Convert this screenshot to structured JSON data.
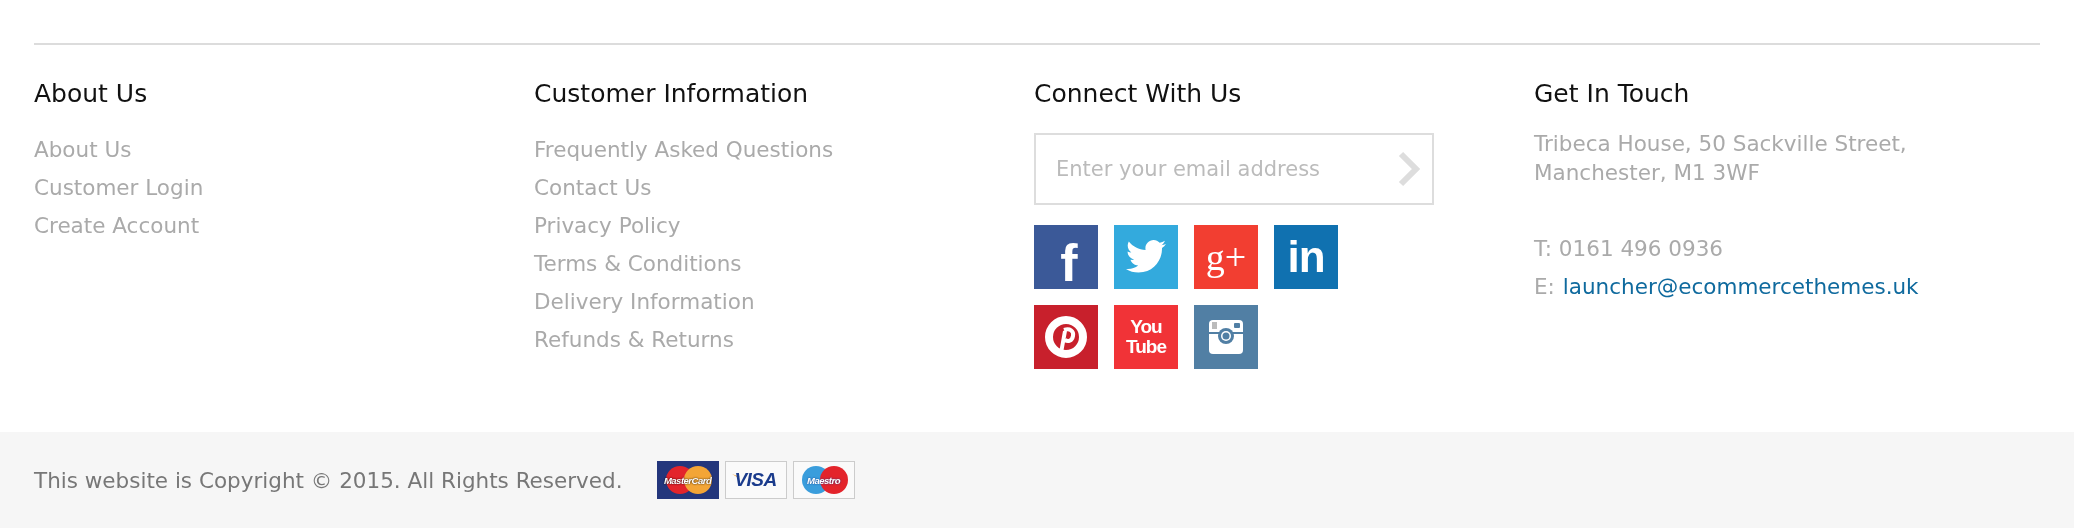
{
  "columns": [
    {
      "heading": "About Us",
      "links": [
        "About Us",
        "Customer Login",
        "Create Account"
      ]
    },
    {
      "heading": "Customer Information",
      "links": [
        "Frequently Asked Questions",
        "Contact Us",
        "Privacy Policy",
        "Terms & Conditions",
        "Delivery Information",
        "Refunds & Returns"
      ]
    }
  ],
  "connect": {
    "heading": "Connect With Us",
    "newsletter": {
      "placeholder": "Enter your email address"
    },
    "social": [
      {
        "kind": "facebook",
        "label": "f",
        "color": "#3b5998"
      },
      {
        "kind": "twitter",
        "color": "#33aadd"
      },
      {
        "kind": "googleplus",
        "label": "g+",
        "color": "#f23e31"
      },
      {
        "kind": "linkedin",
        "label": "in",
        "color": "#1071b0"
      },
      {
        "kind": "pinterest",
        "color": "#c8202c"
      },
      {
        "kind": "youtube",
        "label": "You Tube",
        "color": "#f13337"
      },
      {
        "kind": "instagram",
        "color": "#517fa4"
      }
    ]
  },
  "contact": {
    "heading": "Get In Touch",
    "address": [
      "Tribeca House, 50 Sackville Street,",
      "Manchester, M1 3WF"
    ],
    "phone": "T: 0161 496 0936",
    "email_label": "E:",
    "email": "launcher@ecommercethemes.uk"
  },
  "bottom_bar": {
    "copyright": "This website is Copyright © 2015. All Rights Reserved.",
    "payment_cards": [
      {
        "kind": "mastercard",
        "label": "MasterCard"
      },
      {
        "kind": "visa",
        "label": "VISA"
      },
      {
        "kind": "maestro",
        "label": "Maestro"
      }
    ]
  }
}
